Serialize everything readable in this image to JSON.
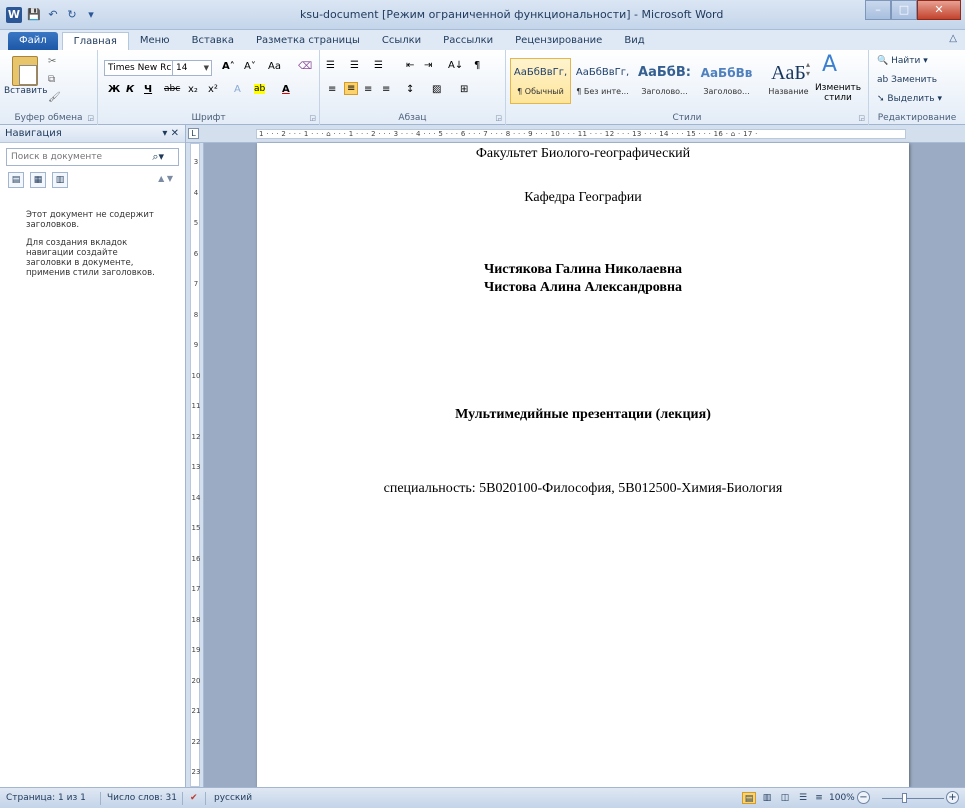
{
  "window": {
    "title": "ksu-document [Режим ограниченной функциональности] - Microsoft Word",
    "app_icon": "W",
    "buttons": {
      "minimize": "–",
      "maximize": "□",
      "close": "✕"
    }
  },
  "quick_access": {
    "save": "💾",
    "undo": "↶",
    "redo": "↻",
    "customize": "▾"
  },
  "tabs": [
    "Файл",
    "Главная",
    "Меню",
    "Вставка",
    "Разметка страницы",
    "Ссылки",
    "Рассылки",
    "Рецензирование",
    "Вид"
  ],
  "ribbon": {
    "clipboard": {
      "label": "Буфер обмена",
      "paste": "Вставить"
    },
    "font": {
      "label": "Шрифт",
      "family": "Times New Rc",
      "size": "14",
      "grow": "A˄",
      "shrink": "A˅",
      "case": "Aa",
      "clear": "⌫",
      "bold": "Ж",
      "italic": "К",
      "underline": "Ч",
      "strike": "abc",
      "subscript": "x₂",
      "superscript": "x²",
      "effects": "A",
      "highlight": "ab",
      "color": "A"
    },
    "paragraph": {
      "label": "Абзац",
      "bullets": "☰",
      "numbering": "☰",
      "multilevel": "☰",
      "outdent": "⇤",
      "indent": "⇥",
      "sort": "A↓",
      "marks": "¶",
      "align_left": "≡",
      "align_center": "≡",
      "align_right": "≡",
      "justify": "≡",
      "spacing": "↕",
      "shading": "▨",
      "borders": "⊞"
    },
    "styles": {
      "label": "Стили",
      "items": [
        {
          "sample": "АаБбВвГг,",
          "name": "¶ Обычный"
        },
        {
          "sample": "АаБбВвГг,",
          "name": "¶ Без инте..."
        },
        {
          "sample": "АаБбВ:",
          "name": "Заголово..."
        },
        {
          "sample": "АаБбВв",
          "name": "Заголово..."
        },
        {
          "sample": "AaБ",
          "name": "Название"
        }
      ],
      "change": "Изменить стили"
    },
    "editing": {
      "label": "Редактирование",
      "find": "Найти",
      "replace": "Заменить",
      "select": "Выделить"
    }
  },
  "navigation": {
    "title": "Навигация",
    "search_placeholder": "Поиск в документе",
    "message1": "Этот документ не содержит заголовков.",
    "message2": "Для создания вкладок навигации создайте заголовки в документе, применив стили заголовков."
  },
  "ruler": {
    "horizontal": "1 · · · 2 · · · 1 · · · ⌂ · · · 1 · · · 2 · · · 3 · · · 4 · · · 5 · · · 6 · · · 7 · · · 8 · · · 9 · · · 10 · · · 11 · · · 12 · · · 13 · · · 14 · · · 15 · · · 16 · ⌂ · 17 ·",
    "vertical": [
      "3",
      "4",
      "5",
      "6",
      "7",
      "8",
      "9",
      "10",
      "11",
      "12",
      "13",
      "14",
      "15",
      "16",
      "17",
      "18",
      "19",
      "20",
      "21",
      "22",
      "23"
    ]
  },
  "document": {
    "faculty": "Факультет Биолого-географический",
    "department": "Кафедра Географии",
    "author1": "Чистякова Галина Николаевна",
    "author2": "Чистова Алина Александровна",
    "title": "Мультимедийные презентации (лекция)",
    "specialty": "специальность: 5В020100-Философия, 5В012500-Химия-Биология"
  },
  "status": {
    "page": "Страница: 1 из 1",
    "words": "Число слов: 31",
    "language": "русский",
    "zoom": "100%"
  }
}
